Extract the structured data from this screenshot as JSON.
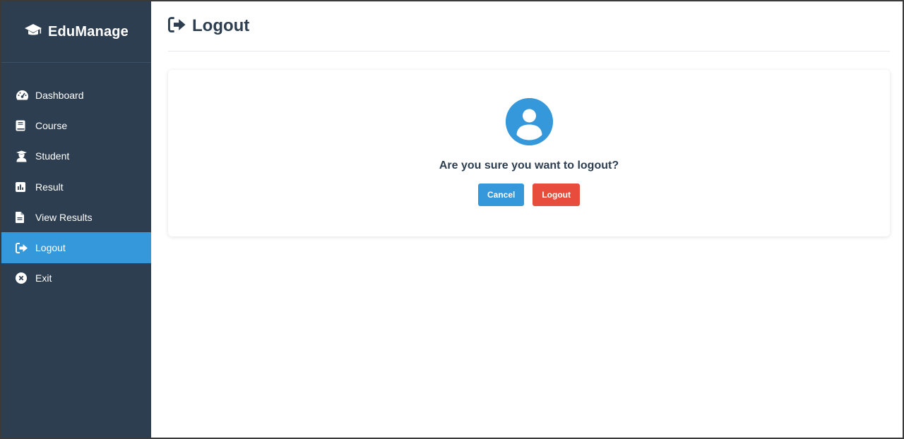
{
  "app": {
    "brand": "EduManage",
    "brand_icon": "graduation-cap-icon"
  },
  "sidebar": {
    "items": [
      {
        "label": "Dashboard",
        "icon": "dashboard-gauge-icon",
        "active": false
      },
      {
        "label": "Course",
        "icon": "book-icon",
        "active": false
      },
      {
        "label": "Student",
        "icon": "student-icon",
        "active": false
      },
      {
        "label": "Result",
        "icon": "bar-chart-icon",
        "active": false
      },
      {
        "label": "View Results",
        "icon": "document-icon",
        "active": false
      },
      {
        "label": "Logout",
        "icon": "sign-out-icon",
        "active": true
      },
      {
        "label": "Exit",
        "icon": "close-circle-icon",
        "active": false
      }
    ]
  },
  "page": {
    "title": "Logout",
    "title_icon": "sign-out-icon"
  },
  "dialog": {
    "icon": "user-circle-icon",
    "question": "Are you sure you want to logout?",
    "cancel_label": "Cancel",
    "logout_label": "Logout"
  },
  "colors": {
    "sidebar_bg": "#2c3e50",
    "accent": "#3498db",
    "danger": "#e74c3c"
  }
}
